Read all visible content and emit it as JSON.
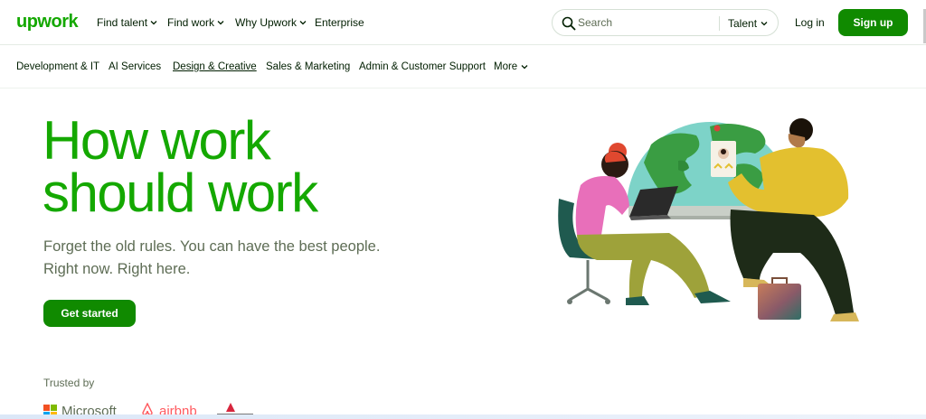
{
  "header": {
    "logo": "upwork",
    "nav": [
      {
        "label": "Find talent",
        "has_dropdown": true
      },
      {
        "label": "Find work",
        "has_dropdown": true
      },
      {
        "label": "Why Upwork",
        "has_dropdown": true
      },
      {
        "label": "Enterprise",
        "has_dropdown": false
      }
    ],
    "search": {
      "placeholder": "Search",
      "type": "Talent"
    },
    "login": "Log in",
    "signup": "Sign up"
  },
  "categories": [
    {
      "label": "Development & IT"
    },
    {
      "label": "AI Services"
    },
    {
      "label": "Design & Creative",
      "underlined": true
    },
    {
      "label": "Sales & Marketing"
    },
    {
      "label": "Admin & Customer Support"
    },
    {
      "label": "More"
    }
  ],
  "hero": {
    "title_line1": "How work",
    "title_line2": "should work",
    "subtitle_line1": "Forget the old rules. You can have the best people.",
    "subtitle_line2": "Right now. Right here.",
    "cta": "Get started"
  },
  "trusted": {
    "label": "Trusted by",
    "brands": [
      "Microsoft",
      "airbnb",
      "BISSELL"
    ]
  },
  "colors": {
    "brand_green": "#14a800",
    "button_green": "#108a00",
    "text_dark": "#001e00",
    "text_muted": "#5e6d55"
  },
  "icons": {
    "search": "search-icon",
    "dropdown": "chevron-down-icon"
  }
}
